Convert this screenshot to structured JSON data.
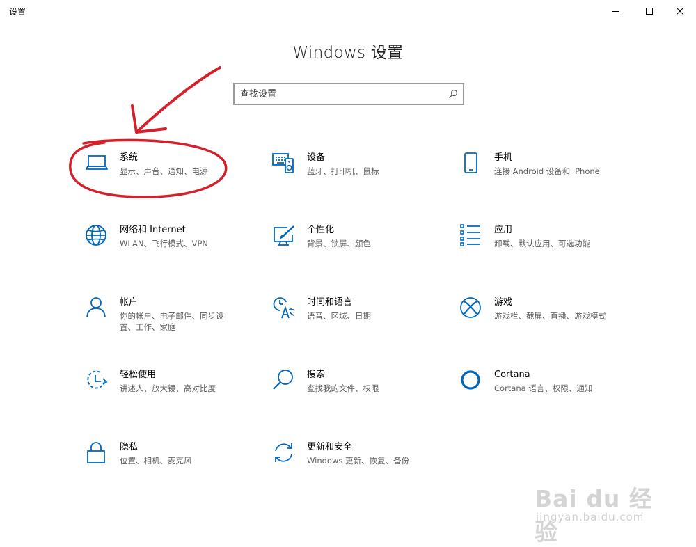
{
  "window": {
    "title": "设置",
    "controls": {
      "minimize": "minimize-icon",
      "maximize": "maximize-icon",
      "close": "close-icon"
    }
  },
  "header": {
    "title": "Windows 设置"
  },
  "search": {
    "placeholder": "查找设置",
    "value": "",
    "icon": "search-icon"
  },
  "colors": {
    "accent": "#0067c0",
    "annotation": "#d4202a",
    "watermark": "#d4d4d4"
  },
  "tiles": [
    {
      "title": "系统",
      "description": "显示、声音、通知、电源",
      "icon": "laptop-icon"
    },
    {
      "title": "设备",
      "description": "蓝牙、打印机、鼠标",
      "icon": "keyboard-speaker-icon"
    },
    {
      "title": "手机",
      "description": "连接 Android 设备和 iPhone",
      "icon": "phone-icon"
    },
    {
      "title": "网络和 Internet",
      "description": "WLAN、飞行模式、VPN",
      "icon": "globe-icon"
    },
    {
      "title": "个性化",
      "description": "背景、锁屏、颜色",
      "icon": "paint-brush-icon"
    },
    {
      "title": "应用",
      "description": "卸载、默认应用、可选功能",
      "icon": "app-list-icon"
    },
    {
      "title": "帐户",
      "description": "你的帐户、电子邮件、同步设置、工作、家庭",
      "icon": "person-icon"
    },
    {
      "title": "时间和语言",
      "description": "语音、区域、日期",
      "icon": "time-language-icon"
    },
    {
      "title": "游戏",
      "description": "游戏栏、截屏、直播、游戏模式",
      "icon": "xbox-icon"
    },
    {
      "title": "轻松使用",
      "description": "讲述人、放大镜、高对比度",
      "icon": "ease-of-access-icon"
    },
    {
      "title": "搜索",
      "description": "查找我的文件、权限",
      "icon": "search-magnifier-icon"
    },
    {
      "title": "Cortana",
      "description": "Cortana 语言、权限、通知",
      "icon": "cortana-ring-icon"
    },
    {
      "title": "隐私",
      "description": "位置、相机、麦克风",
      "icon": "lock-icon"
    },
    {
      "title": "更新和安全",
      "description": "Windows 更新、恢复、备份",
      "icon": "sync-icon"
    }
  ],
  "watermark": {
    "logo": "Bai du 经验",
    "url": "jingyan.baidu.com"
  }
}
